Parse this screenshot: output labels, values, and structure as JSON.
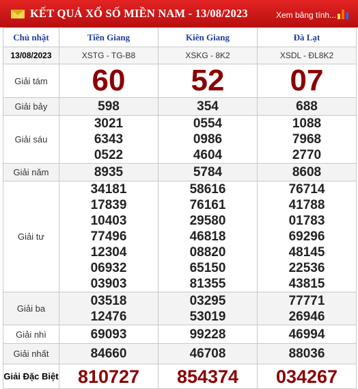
{
  "header": {
    "title": "KẾT QUẢ XỔ SỐ MIỀN NAM - 13/08/2023",
    "more_link": "Xem bảng tính...",
    "accent_color": "#c91414"
  },
  "table": {
    "day_label": "Chủ nhật",
    "date": "13/08/2023",
    "provinces": [
      {
        "name": "Tiền Giang",
        "code": "XSTG - TG-B8"
      },
      {
        "name": "Kiên Giang",
        "code": "XSKG - 8K2"
      },
      {
        "name": "Đà Lạt",
        "code": "XSDL - ĐL8K2"
      }
    ],
    "prizes": {
      "g8": {
        "label": "Giải tám",
        "values": [
          "60",
          "52",
          "07"
        ]
      },
      "g7": {
        "label": "Giải bảy",
        "values": [
          "598",
          "354",
          "688"
        ]
      },
      "g6": {
        "label": "Giải sáu",
        "values": [
          [
            "3021",
            "6343",
            "0522"
          ],
          [
            "0554",
            "0986",
            "4604"
          ],
          [
            "1088",
            "7968",
            "2770"
          ]
        ]
      },
      "g5": {
        "label": "Giải năm",
        "values": [
          "8935",
          "5784",
          "8608"
        ]
      },
      "g4": {
        "label": "Giải tư",
        "values": [
          [
            "34181",
            "17839",
            "10403",
            "77496",
            "12304",
            "06932",
            "03903"
          ],
          [
            "58616",
            "76161",
            "29580",
            "46818",
            "08820",
            "65150",
            "81355"
          ],
          [
            "76714",
            "41788",
            "01783",
            "69296",
            "48145",
            "22536",
            "43815"
          ]
        ]
      },
      "g3": {
        "label": "Giải ba",
        "values": [
          [
            "03518",
            "12476"
          ],
          [
            "03295",
            "53019"
          ],
          [
            "77771",
            "26946"
          ]
        ]
      },
      "g2": {
        "label": "Giải nhì",
        "values": [
          "69093",
          "99228",
          "46994"
        ]
      },
      "g1": {
        "label": "Giải nhất",
        "values": [
          "84660",
          "46708",
          "88036"
        ]
      },
      "db": {
        "label": "Giải Đặc Biệt",
        "values": [
          "810727",
          "854374",
          "034267"
        ]
      }
    }
  }
}
